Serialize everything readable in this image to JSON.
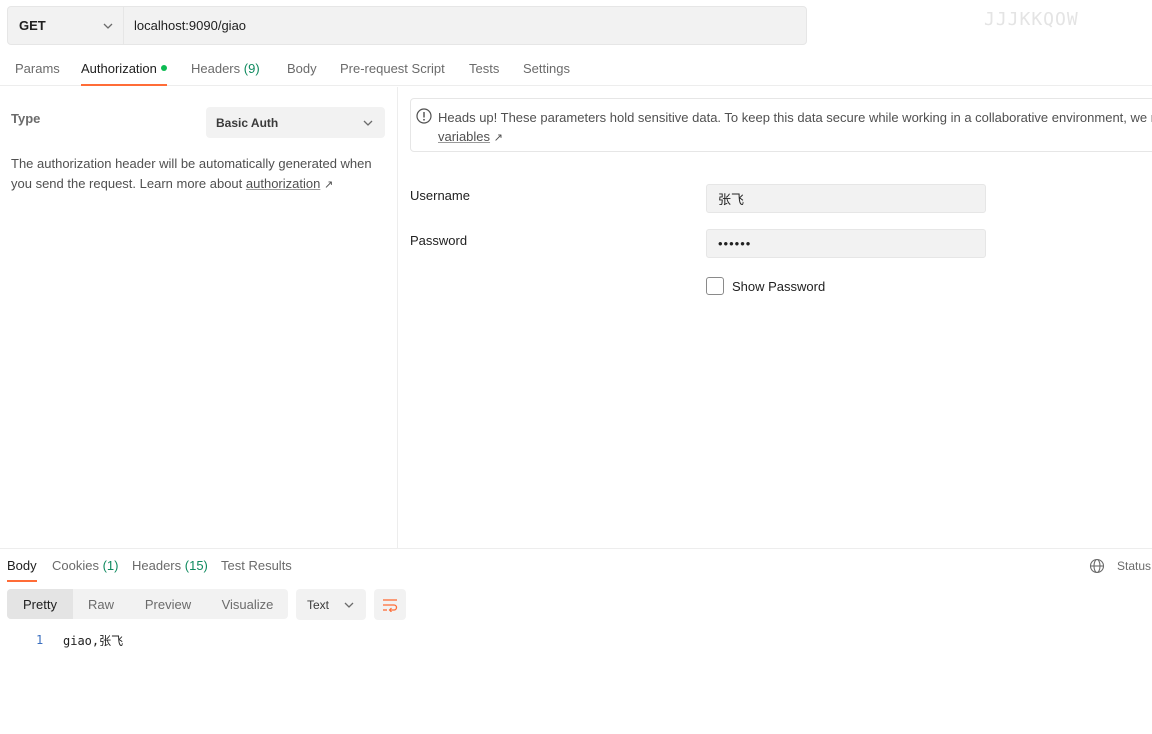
{
  "request": {
    "method": "GET",
    "url": "localhost:9090/giao",
    "ghost_text": "JJJKKQOW"
  },
  "request_tabs": [
    {
      "label": "Params"
    },
    {
      "label": "Authorization",
      "active": true,
      "indicator": true
    },
    {
      "label": "Headers",
      "count": "(9)"
    },
    {
      "label": "Body"
    },
    {
      "label": "Pre-request Script"
    },
    {
      "label": "Tests"
    },
    {
      "label": "Settings"
    }
  ],
  "auth": {
    "type_label": "Type",
    "type_value": "Basic Auth",
    "description": "The authorization header will be automatically generated when you send the request. Learn more about",
    "description_link": "authorization",
    "link_arrow": "↗"
  },
  "notice": {
    "text": "Heads up! These parameters hold sensitive data. To keep this data secure while working in a collaborative environment, we rec",
    "link": "variables",
    "link_arrow": "↗"
  },
  "fields": {
    "username_label": "Username",
    "username_value": "张飞",
    "password_label": "Password",
    "password_value": "••••••",
    "show_password_label": "Show Password"
  },
  "response_tabs": [
    {
      "label": "Body",
      "active": true
    },
    {
      "label": "Cookies",
      "count": "(1)"
    },
    {
      "label": "Headers",
      "count": "(15)"
    },
    {
      "label": "Test Results"
    }
  ],
  "status_label": "Status:",
  "view_modes": [
    "Pretty",
    "Raw",
    "Preview",
    "Visualize"
  ],
  "format": "Text",
  "response_body": [
    {
      "line": "1",
      "text": "giao,张飞"
    }
  ],
  "colors": {
    "accent": "#ff6c37",
    "indicator": "#0cbb52",
    "count": "#0f8a5f"
  }
}
